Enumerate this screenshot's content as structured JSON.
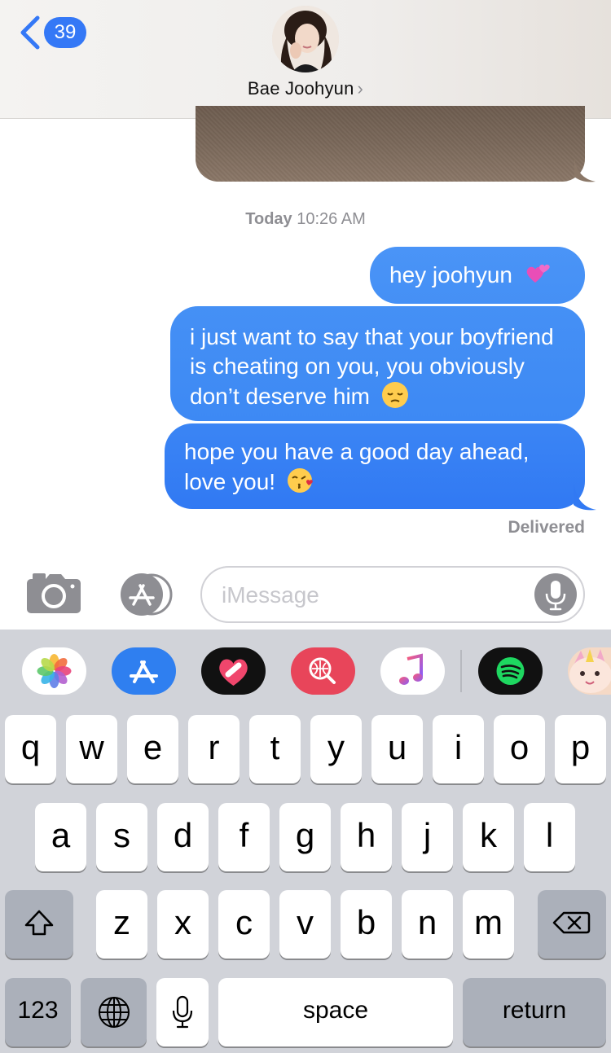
{
  "header": {
    "back_count": "39",
    "contact_name": "Bae Joohyun",
    "chevron": "›"
  },
  "conversation": {
    "timestamp_day": "Today",
    "timestamp_time": "10:26 AM",
    "messages": [
      {
        "text": "hey joohyun",
        "emoji": "two-hearts"
      },
      {
        "text": "i just want to say that your boyfriend is cheating on you, you obviously don’t deserve him",
        "emoji": "pensive-face"
      },
      {
        "text": "hope you have a good day ahead, love you!",
        "emoji": "kissing-face"
      }
    ],
    "status": "Delivered"
  },
  "input": {
    "placeholder": "iMessage"
  },
  "apps": [
    {
      "name": "photos-app-icon",
      "bg": "#ffffff"
    },
    {
      "name": "app-store-app-icon",
      "bg": "#2f7ff0"
    },
    {
      "name": "digital-touch-app-icon",
      "bg": "#111111"
    },
    {
      "name": "images-search-app-icon",
      "bg": "#e8455a"
    },
    {
      "name": "music-app-icon",
      "bg": "#ffffff"
    },
    {
      "name": "spotify-app-icon",
      "bg": "#111111"
    },
    {
      "name": "animoji-app-icon",
      "bg": "#f5d9c6"
    }
  ],
  "keyboard": {
    "row1": [
      "q",
      "w",
      "e",
      "r",
      "t",
      "y",
      "u",
      "i",
      "o",
      "p"
    ],
    "row2": [
      "a",
      "s",
      "d",
      "f",
      "g",
      "h",
      "j",
      "k",
      "l"
    ],
    "row3": [
      "z",
      "x",
      "c",
      "v",
      "b",
      "n",
      "m"
    ],
    "numbers_label": "123",
    "space_label": "space",
    "return_label": "return"
  },
  "colors": {
    "accent": "#3478f6",
    "bubble": "#3a86f5",
    "keyboard_bg": "#d1d3d9",
    "dark_key": "#abb0ba"
  }
}
